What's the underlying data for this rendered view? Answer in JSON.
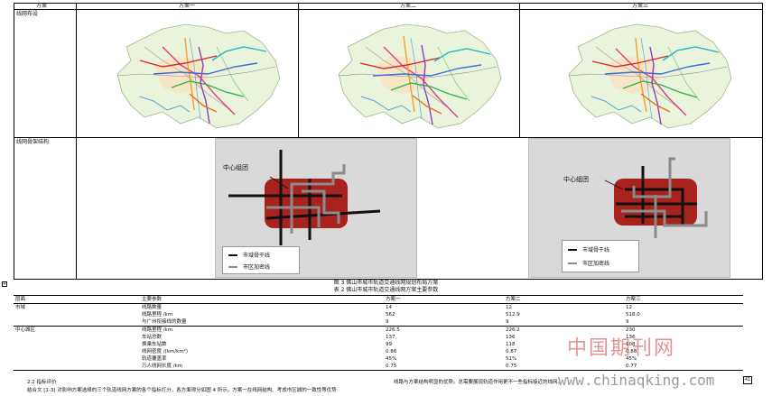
{
  "table1": {
    "headers": [
      "方案",
      "方案一",
      "方案二",
      "方案三"
    ],
    "row_labels": [
      "线网布设",
      "线网骨架结构"
    ]
  },
  "diagram": {
    "center_label": "中心组团",
    "legend": [
      "市域骨干线",
      "市区加密线"
    ]
  },
  "figure_caption": "图 3 佛山市城市轨道交通线网规划布局方案",
  "table_caption": "表 2 佛山市城市轨道交通线网方案主要参数",
  "table2": {
    "headers": [
      "层面",
      "主要参数",
      "方案一",
      "方案二",
      "方案三"
    ],
    "groups": [
      {
        "label": "市域",
        "rows": [
          [
            "线路数量",
            "14",
            "12",
            "12"
          ],
          [
            "线路里程 /km",
            "562",
            "512.9",
            "518.0"
          ],
          [
            "与广州衔接线的数量",
            "9",
            "9",
            "9"
          ]
        ]
      },
      {
        "label": "中心城区",
        "rows": [
          [
            "线路里程 /km",
            "226.5",
            "226.2",
            "230"
          ],
          [
            "车站总数",
            "137",
            "136",
            "136"
          ],
          [
            "换乘车站数",
            "99",
            "118",
            "108"
          ],
          [
            "线网密度 /(km/km²)",
            "0.86",
            "0.87",
            "0.88"
          ],
          [
            "轨道覆盖率",
            "45%",
            "51%",
            "45%"
          ],
          [
            "万人线网长度 /km",
            "0.75",
            "0.75",
            "0.77"
          ]
        ]
      }
    ]
  },
  "footer": {
    "section": "2.2 指标评价",
    "left_text": "结合文 [1-3] 对影响方案选择的三个轨道线网方案的各个指标打分，各方面得分如图 4 所示。方案一在线网结构、考虑市区城的一致性等优势",
    "right_text": "线路与方案结构明显的优势。总需要展现轨道作用更不一些指标接近的线网。",
    "page_number": "41"
  },
  "watermark": {
    "cn": "中国期刊网",
    "url": "www.chinaqking.com"
  },
  "colors": {
    "red_block": "#a8231d",
    "trunk": "#111111",
    "feeder": "#8c8c8c"
  }
}
